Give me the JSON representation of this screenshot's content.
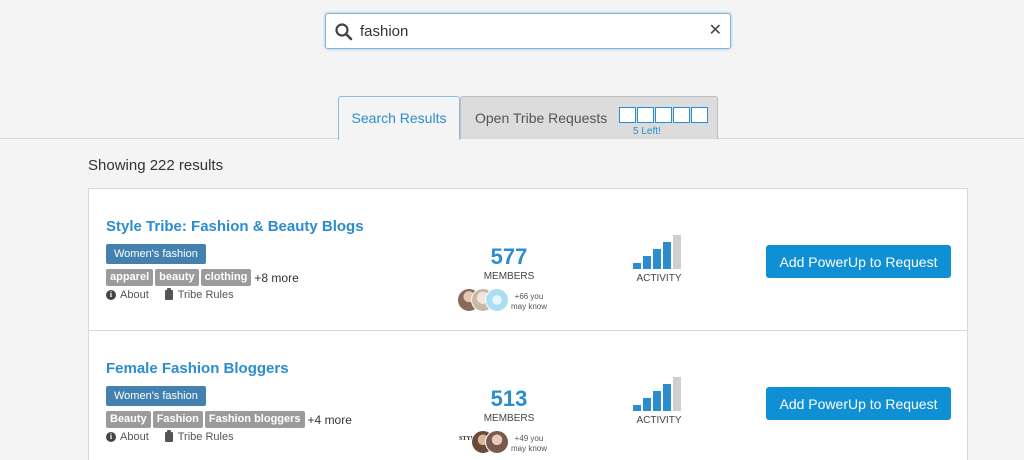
{
  "search": {
    "value": "fashion",
    "placeholder": ""
  },
  "tabs": {
    "search_results": "Search Results",
    "open_requests": "Open Tribe Requests",
    "slots_left": "5 Left!"
  },
  "results_count": "Showing 222 results",
  "colors": {
    "accent": "#2b8dce",
    "category": "#4381b1",
    "tag": "#9b9b9b",
    "button": "#0f8fd4",
    "bar_active": "#2b8dce",
    "bar_inactive": "#cfcfcf"
  },
  "tribes": [
    {
      "title": "Style Tribe: Fashion & Beauty Blogs",
      "category": "Women's fashion",
      "tags": [
        "apparel",
        "beauty",
        "clothing"
      ],
      "more": "+8 more",
      "about": "About",
      "rules": "Tribe Rules",
      "members": "577",
      "members_label": "MEMBERS",
      "know_line1": "+66 you",
      "know_line2": "may know",
      "activity_label": "ACTIVITY",
      "activity_level": 4,
      "activity_max": 5,
      "button": "Add PowerUp to Request"
    },
    {
      "title": "Female Fashion Bloggers",
      "category": "Women's fashion",
      "tags": [
        "Beauty",
        "Fashion",
        "Fashion bloggers"
      ],
      "more": "+4 more",
      "about": "About",
      "rules": "Tribe Rules",
      "members": "513",
      "members_label": "MEMBERS",
      "know_line1": "+49 you",
      "know_line2": "may know",
      "activity_label": "ACTIVITY",
      "activity_level": 4,
      "activity_max": 5,
      "button": "Add PowerUp to Request"
    }
  ]
}
